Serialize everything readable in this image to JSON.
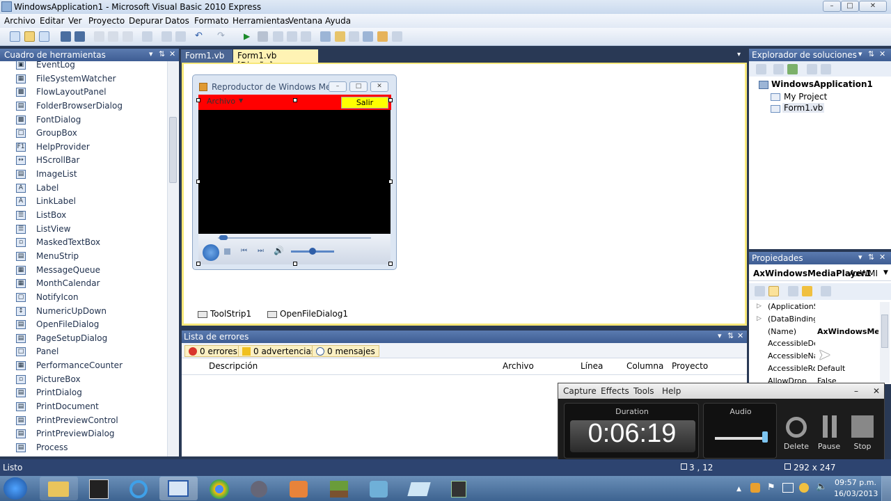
{
  "window": {
    "title": "WindowsApplication1 - Microsoft Visual Basic 2010 Express"
  },
  "menubar": {
    "items": [
      "Archivo",
      "Editar",
      "Ver",
      "Proyecto",
      "Depurar",
      "Datos",
      "Formato",
      "Herramientas",
      "Ventana",
      "Ayuda"
    ]
  },
  "toolbox": {
    "title": "Cuadro de herramientas",
    "items": [
      "EventLog",
      "FileSystemWatcher",
      "FlowLayoutPanel",
      "FolderBrowserDialog",
      "FontDialog",
      "GroupBox",
      "HelpProvider",
      "HScrollBar",
      "ImageList",
      "Label",
      "LinkLabel",
      "ListBox",
      "ListView",
      "MaskedTextBox",
      "MenuStrip",
      "MessageQueue",
      "MonthCalendar",
      "NotifyIcon",
      "NumericUpDown",
      "OpenFileDialog",
      "PageSetupDialog",
      "Panel",
      "PerformanceCounter",
      "PictureBox",
      "PrintDialog",
      "PrintDocument",
      "PrintPreviewControl",
      "PrintPreviewDialog",
      "Process"
    ]
  },
  "tabs": [
    "Form1.vb",
    "Form1.vb [Diseño]"
  ],
  "form": {
    "title": "Reproductor de Windows Media",
    "menu_label": "Archivo",
    "exit_label": "Salir"
  },
  "tray": [
    "ToolStrip1",
    "OpenFileDialog1"
  ],
  "error_list": {
    "title": "Lista de errores",
    "filters": [
      "0 errores",
      "0 advertencias",
      "0 mensajes"
    ],
    "columns": [
      "Descripción",
      "Archivo",
      "Línea",
      "Columna",
      "Proyecto"
    ]
  },
  "solution_explorer": {
    "title": "Explorador de soluciones",
    "project": "WindowsApplication1",
    "children": [
      "My Project",
      "Form1.vb"
    ]
  },
  "properties": {
    "title": "Propiedades",
    "object": "AxWindowsMediaPlayer1",
    "object_type": "AxWMI",
    "rows": [
      {
        "name": "(ApplicationS",
        "value": ""
      },
      {
        "name": "(DataBinding:",
        "value": ""
      },
      {
        "name": "(Name)",
        "value": "AxWindowsMe"
      },
      {
        "name": "AccessibleDes",
        "value": ""
      },
      {
        "name": "AccessibleNa",
        "value": ""
      },
      {
        "name": "AccessibleRol",
        "value": "Default"
      },
      {
        "name": "AllowDrop",
        "value": "False"
      }
    ]
  },
  "recorder": {
    "menu": [
      "Capture",
      "Effects",
      "Tools",
      "Help"
    ],
    "duration_label": "Duration",
    "duration": "0:06:19",
    "audio_label": "Audio",
    "buttons": [
      "Delete",
      "Pause",
      "Stop"
    ]
  },
  "status": {
    "text": "Listo",
    "position": "3 , 12",
    "size": "292 x 247"
  },
  "taskbar": {
    "time": "09:57 p.m.",
    "date": "16/03/2013"
  }
}
